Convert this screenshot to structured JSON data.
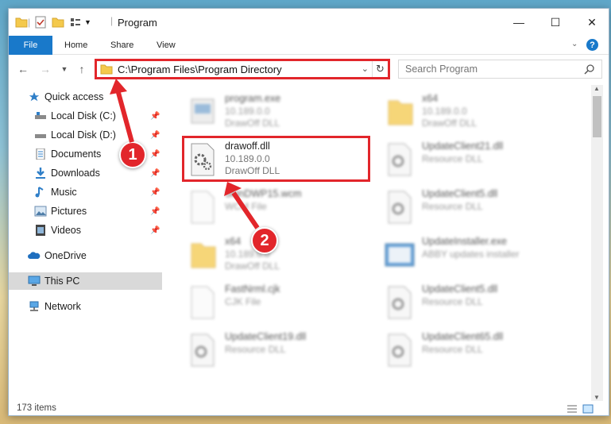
{
  "window": {
    "title": "Program",
    "controls": {
      "minimize": "—",
      "maximize": "☐",
      "close": "✕"
    }
  },
  "ribbon": {
    "tabs": [
      {
        "label": "File"
      },
      {
        "label": "Home"
      },
      {
        "label": "Share"
      },
      {
        "label": "View"
      }
    ],
    "help": "?"
  },
  "address_bar": {
    "path": "C:\\Program Files\\Program Directory",
    "search_placeholder": "Search Program"
  },
  "sidebar": {
    "items": [
      {
        "label": "Quick access",
        "icon": "star-icon",
        "pinned": false
      },
      {
        "label": "Local Disk (C:)",
        "icon": "drive-icon",
        "pinned": true
      },
      {
        "label": "Local Disk (D:)",
        "icon": "drive-icon",
        "pinned": true
      },
      {
        "label": "Documents",
        "icon": "documents-icon",
        "pinned": true
      },
      {
        "label": "Downloads",
        "icon": "downloads-icon",
        "pinned": true
      },
      {
        "label": "Music",
        "icon": "music-icon",
        "pinned": true
      },
      {
        "label": "Pictures",
        "icon": "pictures-icon",
        "pinned": true
      },
      {
        "label": "Videos",
        "icon": "videos-icon",
        "pinned": true
      },
      {
        "label": "OneDrive",
        "icon": "onedrive-icon",
        "pinned": false
      },
      {
        "label": "This PC",
        "icon": "pc-icon",
        "pinned": false
      },
      {
        "label": "Network",
        "icon": "network-icon",
        "pinned": false
      }
    ]
  },
  "files": [
    {
      "name": "program.exe",
      "line1": "10.189.0.0",
      "line2": "DrawOff DLL",
      "icon": "exe-icon"
    },
    {
      "name": "x64",
      "line1": "10.189.0.0",
      "line2": "DrawOff DLL",
      "icon": "folder-icon"
    },
    {
      "name": "drawoff.dll",
      "line1": "10.189.0.0",
      "line2": "DrawOff DLL",
      "icon": "dll-icon"
    },
    {
      "name": "UpdateClient21.dll",
      "line1": "Resource DLL",
      "line2": "",
      "icon": "dll-icon"
    },
    {
      "name": "SkinDWP15.wcm",
      "line1": "WCM File",
      "line2": "",
      "icon": "file-icon"
    },
    {
      "name": "UpdateClient5.dll",
      "line1": "Resource DLL",
      "line2": "",
      "icon": "dll-icon"
    },
    {
      "name": "x64",
      "line1": "10.189.0.0",
      "line2": "DrawOff DLL",
      "icon": "folder-icon"
    },
    {
      "name": "UpdateInstaller.exe",
      "line1": "ABBY updates installer",
      "line2": "",
      "icon": "installer-icon"
    },
    {
      "name": "FastNrml.cjk",
      "line1": "CJK File",
      "line2": "",
      "icon": "file-icon"
    },
    {
      "name": "UpdateClient5.dll",
      "line1": "Resource DLL",
      "line2": "",
      "icon": "dll-icon"
    },
    {
      "name": "UpdateClient19.dll",
      "line1": "Resource DLL",
      "line2": "",
      "icon": "dll-icon"
    },
    {
      "name": "UpdateClient65.dll",
      "line1": "Resource DLL",
      "line2": "",
      "icon": "dll-icon"
    }
  ],
  "status": {
    "count": "173 items"
  },
  "callouts": [
    {
      "label": "1"
    },
    {
      "label": "2"
    }
  ],
  "colors": {
    "accent": "#1979ca",
    "highlight_red": "#e2262b",
    "selection": "#cce8ff"
  }
}
